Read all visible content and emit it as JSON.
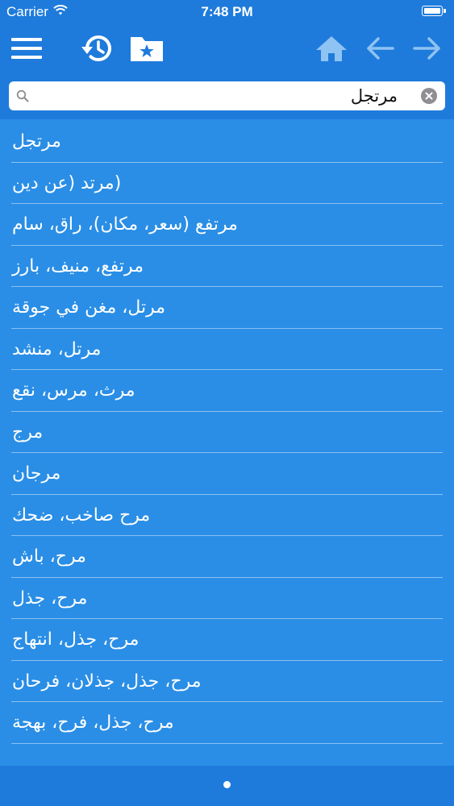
{
  "status_bar": {
    "carrier": "Carrier",
    "time": "7:48 PM"
  },
  "toolbar": {
    "icons": [
      "menu-icon",
      "history-icon",
      "bookmark-folder-icon",
      "home-icon",
      "back-arrow-icon",
      "forward-arrow-icon"
    ],
    "nav_disabled_color": "#8ec3f3"
  },
  "search": {
    "value": "مرتجل",
    "placeholder": ""
  },
  "results": [
    "مرتجل",
    "(مرتد (عن دين",
    "مرتفع (سعر، مكان)، راق، سام",
    "مرتفع، منيف، بارز",
    "مرتل، مغن في جوقة",
    "مرتل، منشد",
    "مرث، مرس، نقع",
    "مرج",
    "مرجان",
    "مرح  صاخب، ضحك",
    "مرح، باش",
    "مرح، جذل",
    "مرح، جذل، انتهاج",
    "مرح، جذل، جذلان، فرحان",
    "مرح، جذل، فرح، بهجة"
  ],
  "colors": {
    "bar_blue": "#1e7bdb",
    "list_blue": "#2a8ee6"
  }
}
